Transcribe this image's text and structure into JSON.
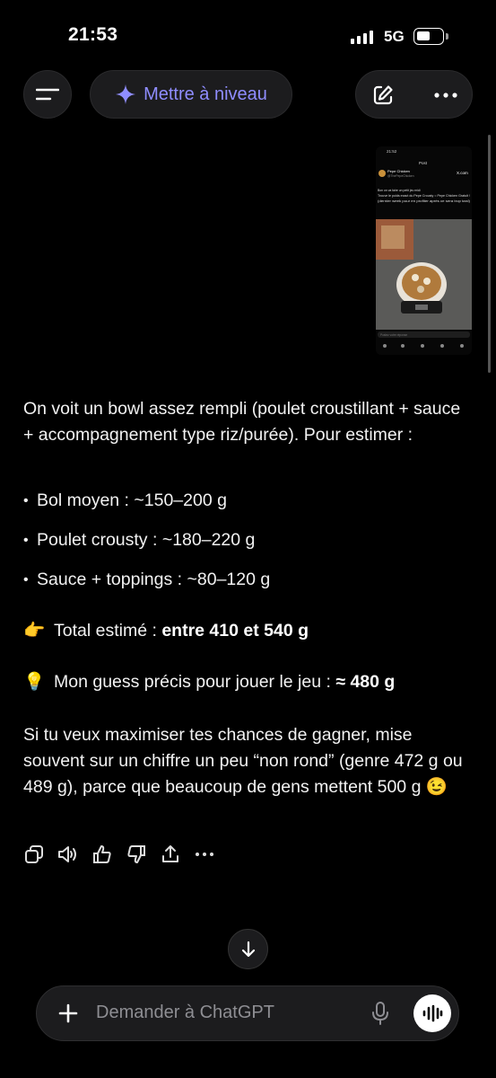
{
  "status": {
    "time": "21:53",
    "network": "5G"
  },
  "header": {
    "upgrade_label": "Mettre à niveau"
  },
  "thumbnail": {
    "time": "21:52",
    "title": "Post",
    "account_name": "Pepe Chicken",
    "handle": "@ThePepeChicken",
    "logo": "X.com",
    "post_line1": "Bon on va faire un petit jeu midi",
    "post_line2": "Trouve le poids exact du Pepe Crousty = Pepe Chicken Gratuit !",
    "post_line3": "(dernier week pour en profiter après ce sera trop tard)",
    "reply_placeholder": "Postez votre réponse"
  },
  "message": {
    "intro": "On voit un bowl assez rempli (poulet croustillant + sauce + accompagnement type riz/purée). Pour estimer :",
    "bullets": [
      "Bol moyen : ~150–200 g",
      "Poulet crousty : ~180–220 g",
      "Sauce + toppings : ~80–120 g"
    ],
    "total_emoji": "👉",
    "total_label": "Total estimé : ",
    "total_value": "entre 410 et 540 g",
    "guess_emoji": "💡",
    "guess_label": "Mon guess précis pour jouer le jeu : ",
    "guess_value": "≈ 480 g",
    "closing": "Si tu veux maximiser tes chances de gagner, mise souvent sur un chiffre un peu “non rond” (genre 472 g ou 489 g), parce que beaucoup de gens mettent 500 g 😉"
  },
  "composer": {
    "placeholder": "Demander à ChatGPT"
  },
  "colors": {
    "accent": "#8f8dff",
    "background": "#000000",
    "surface": "#1c1c1e"
  }
}
